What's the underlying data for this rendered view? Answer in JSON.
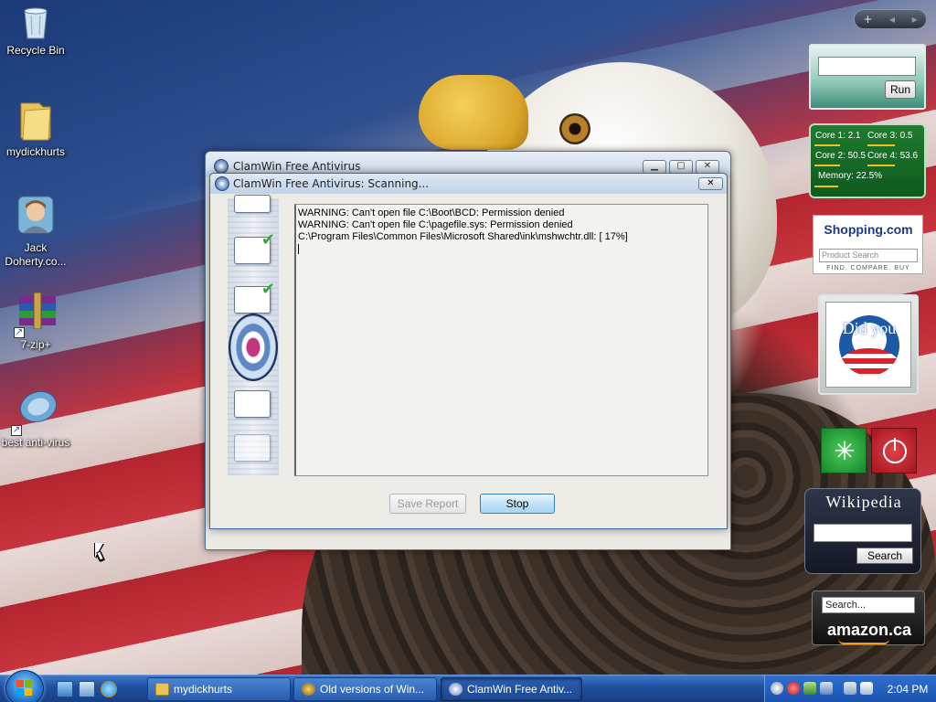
{
  "desktop": {
    "icons": [
      {
        "label": "Recycle Bin"
      },
      {
        "label": "mydickhurts"
      },
      {
        "label": "Jack Doherty.co..."
      },
      {
        "label": "7-zip+"
      },
      {
        "label": "best anti-virus"
      }
    ]
  },
  "sidebar": {
    "controls": {
      "add": "+",
      "prev": "◂",
      "next": "▸"
    },
    "run_gadget": {
      "button_label": "Run"
    },
    "cpu_gadget": {
      "core1": "Core 1: 2.1",
      "core2": "Core 2: 50.5",
      "core3": "Core 3: 0.5",
      "core4": "Core 4: 53.6",
      "memory": "Memory: 22.5%"
    },
    "shopping_gadget": {
      "logo": "Shopping.com",
      "placeholder": "Product Search",
      "tagline": "FIND. COMPARE. BUY"
    },
    "obama_gadget": {
      "text": "Did you"
    },
    "wikipedia_gadget": {
      "title": "Wikipedia",
      "button_label": "Search"
    },
    "amazon_gadget": {
      "search_value": "Search...",
      "logo": "amazon.ca"
    }
  },
  "main_window": {
    "title": "ClamWin Free Antivirus"
  },
  "scan_dialog": {
    "title": "ClamWin Free Antivirus: Scanning...",
    "close_glyph": "✕",
    "log_lines": [
      "WARNING: Can't open file C:\\Boot\\BCD: Permission denied",
      "WARNING: Can't open file C:\\pagefile.sys: Permission denied",
      "C:\\Program Files\\Common Files\\Microsoft Shared\\ink\\mshwchtr.dll: [ 17%]"
    ],
    "save_report_label": "Save Report",
    "stop_label": "Stop"
  },
  "taskbar": {
    "tasks": [
      {
        "label": "mydickhurts",
        "active": false
      },
      {
        "label": "Old versions of Win...",
        "active": false
      },
      {
        "label": "ClamWin Free Antiv...",
        "active": true
      }
    ],
    "clock": "2:04 PM"
  },
  "colors": {
    "taskbar": "#1f4e9e",
    "dialog_border": "#3a68a8",
    "stop_button": "#bfe3f8"
  },
  "icons": [
    "recycle-bin-icon",
    "folder-icon",
    "avatar-icon",
    "archive-icon",
    "shortcut-arrow-icon",
    "windows-logo-icon",
    "shield-icon",
    "checkmark-icon",
    "power-icon",
    "restart-icon",
    "speaker-icon",
    "network-icon"
  ]
}
